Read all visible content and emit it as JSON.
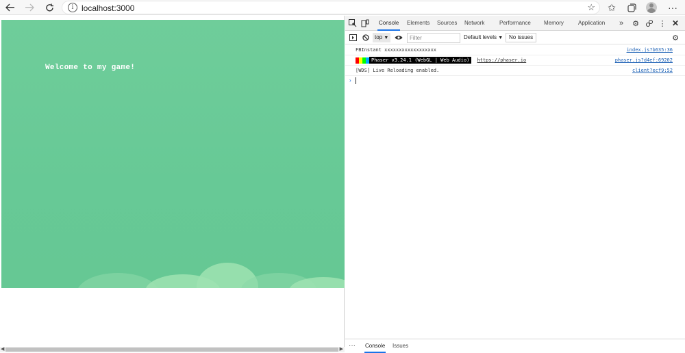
{
  "browser": {
    "url": "localhost:3000",
    "icons": [
      "back-arrow-icon",
      "forward-arrow-icon",
      "refresh-icon",
      "info-icon",
      "favorite-star-icon",
      "favorites-icon",
      "collections-icon",
      "profile-avatar",
      "more-menu-icon"
    ]
  },
  "game": {
    "welcome_text": "Welcome to my game!",
    "background_color": "#6fcd9a",
    "cloud_color": "#9fe3b1"
  },
  "devtools": {
    "tabs": [
      {
        "label": "Console",
        "active": true
      },
      {
        "label": "Elements"
      },
      {
        "label": "Sources"
      },
      {
        "label": "Network"
      },
      {
        "label": "Performance"
      },
      {
        "label": "Memory"
      },
      {
        "label": "Application"
      }
    ],
    "more_tabs": "»",
    "context": "top",
    "filter_placeholder": "Filter",
    "levels_label": "Default levels",
    "issues_label": "No issues",
    "logs": [
      {
        "message": "FBInstant xxxxxxxxxxxxxxxxxx",
        "source": "index.js?b635:36"
      },
      {
        "badge": "Phaser v3.24.1 (WebGL | Web Audio)",
        "link": "https://phaser.io",
        "source": "phaser.js?d4ef:69202"
      },
      {
        "message": "[WDS] Live Reloading enabled.",
        "source": "client?ecf9:52"
      }
    ],
    "prompt_symbol": "›",
    "drawer": {
      "more": "···",
      "tabs": [
        "Console",
        "Issues"
      ]
    },
    "accent_color": "#1a73e8"
  }
}
